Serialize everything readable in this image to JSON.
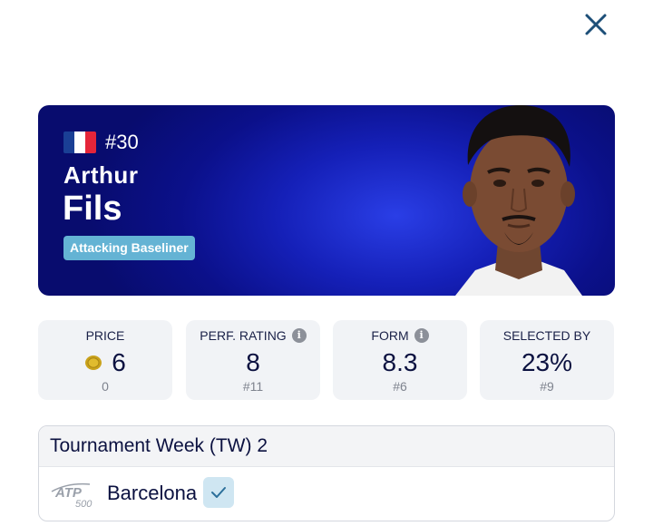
{
  "hero": {
    "rank": "#30",
    "first_name": "Arthur",
    "last_name": "Fils",
    "style_badge": "Attacking Baseliner",
    "country_flag": "france-flag",
    "colors": {
      "background": "#0b108a",
      "badge": "#64b3d4"
    }
  },
  "stats": [
    {
      "label": "PRICE",
      "value": "6",
      "sub": "0",
      "icon": "coin-icon",
      "has_info": false
    },
    {
      "label": "PERF. RATING",
      "value": "8",
      "sub": "#11",
      "has_info": true
    },
    {
      "label": "FORM",
      "value": "8.3",
      "sub": "#6",
      "has_info": true
    },
    {
      "label": "SELECTED BY",
      "value": "23%",
      "sub": "#9",
      "has_info": false
    }
  ],
  "tournament_week": {
    "title": "Tournament Week (TW) 2",
    "tournaments": [
      {
        "name": "Barcelona",
        "logo": "atp-500-logo",
        "logo_text": "ATP",
        "logo_subtext": "500",
        "checked": true
      }
    ]
  },
  "icons": {
    "close": "close-icon",
    "info": "info-icon",
    "check": "check-icon"
  }
}
